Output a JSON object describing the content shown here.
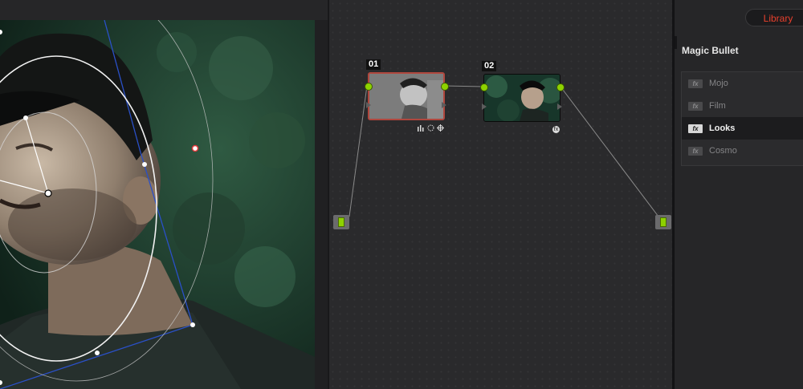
{
  "node_editor": {
    "nodes": [
      {
        "label": "01"
      },
      {
        "label": "02"
      }
    ],
    "fx_badge_glyph": "fx"
  },
  "panel": {
    "library_button": "Library",
    "section_title": "Magic Bullet",
    "items": [
      {
        "label": "Mojo",
        "icon": "fx-plugin-icon",
        "selected": false
      },
      {
        "label": "Film",
        "icon": "fx-plugin-icon",
        "selected": false
      },
      {
        "label": "Looks",
        "icon": "fx-plugin-icon",
        "selected": true
      },
      {
        "label": "Cosmo",
        "icon": "fx-plugin-icon",
        "selected": false
      }
    ],
    "item_icon_glyph": "fx"
  },
  "colors": {
    "accent_red": "#e8402d",
    "port_green": "#8ed200",
    "selected_node_border": "#b0473e",
    "power_window_blue": "#2a50c8"
  }
}
